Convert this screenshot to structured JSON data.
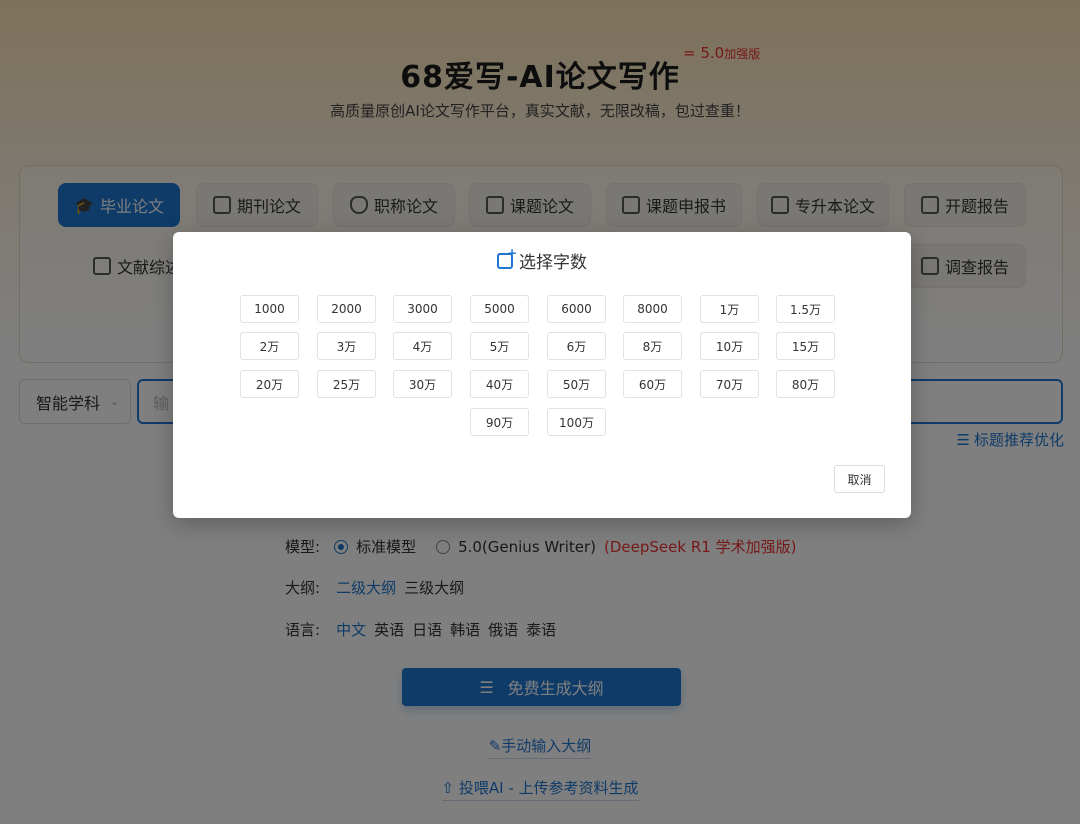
{
  "header": {
    "title": "68爱写-AI论文写作",
    "version_prefix": "= 5.0",
    "version_suffix": "加强版",
    "subtitle": "高质量原创AI论文写作平台，真实文献，无限改稿，包过查重！"
  },
  "categories": {
    "row1": [
      "毕业论文",
      "期刊论文",
      "职称论文",
      "课题论文",
      "课题申报书",
      "专升本论文",
      "开题报告"
    ],
    "row2_left": "文献综述",
    "row2_right": "调查报告",
    "active": "毕业论文"
  },
  "subject": {
    "label": "智能学科"
  },
  "title_input": {
    "placeholder": "输"
  },
  "recommend": {
    "label": "标题推荐优化"
  },
  "model": {
    "label": "模型:",
    "option1": "标准模型",
    "option2": "5.0(Genius Writer)",
    "option2_note": "(DeepSeek R1 学术加强版)"
  },
  "outline": {
    "label": "大纲:",
    "option1": "二级大纲",
    "option2": "三级大纲"
  },
  "language": {
    "label": "语言:",
    "options": [
      "中文",
      "英语",
      "日语",
      "韩语",
      "俄语",
      "泰语"
    ]
  },
  "actions": {
    "generate": "免费生成大纲",
    "manual": "手动输入大纲",
    "upload": "投喂AI - 上传参考资料生成"
  },
  "modal": {
    "title": "选择字数",
    "options": [
      "1000",
      "2000",
      "3000",
      "5000",
      "6000",
      "8000",
      "1万",
      "1.5万",
      "2万",
      "3万",
      "4万",
      "5万",
      "6万",
      "8万",
      "10万",
      "15万",
      "20万",
      "25万",
      "30万",
      "40万",
      "50万",
      "60万",
      "70万",
      "80万",
      "90万",
      "100万"
    ],
    "cancel": "取消"
  },
  "colors": {
    "accent": "#1f76d2",
    "red": "#e33333"
  }
}
